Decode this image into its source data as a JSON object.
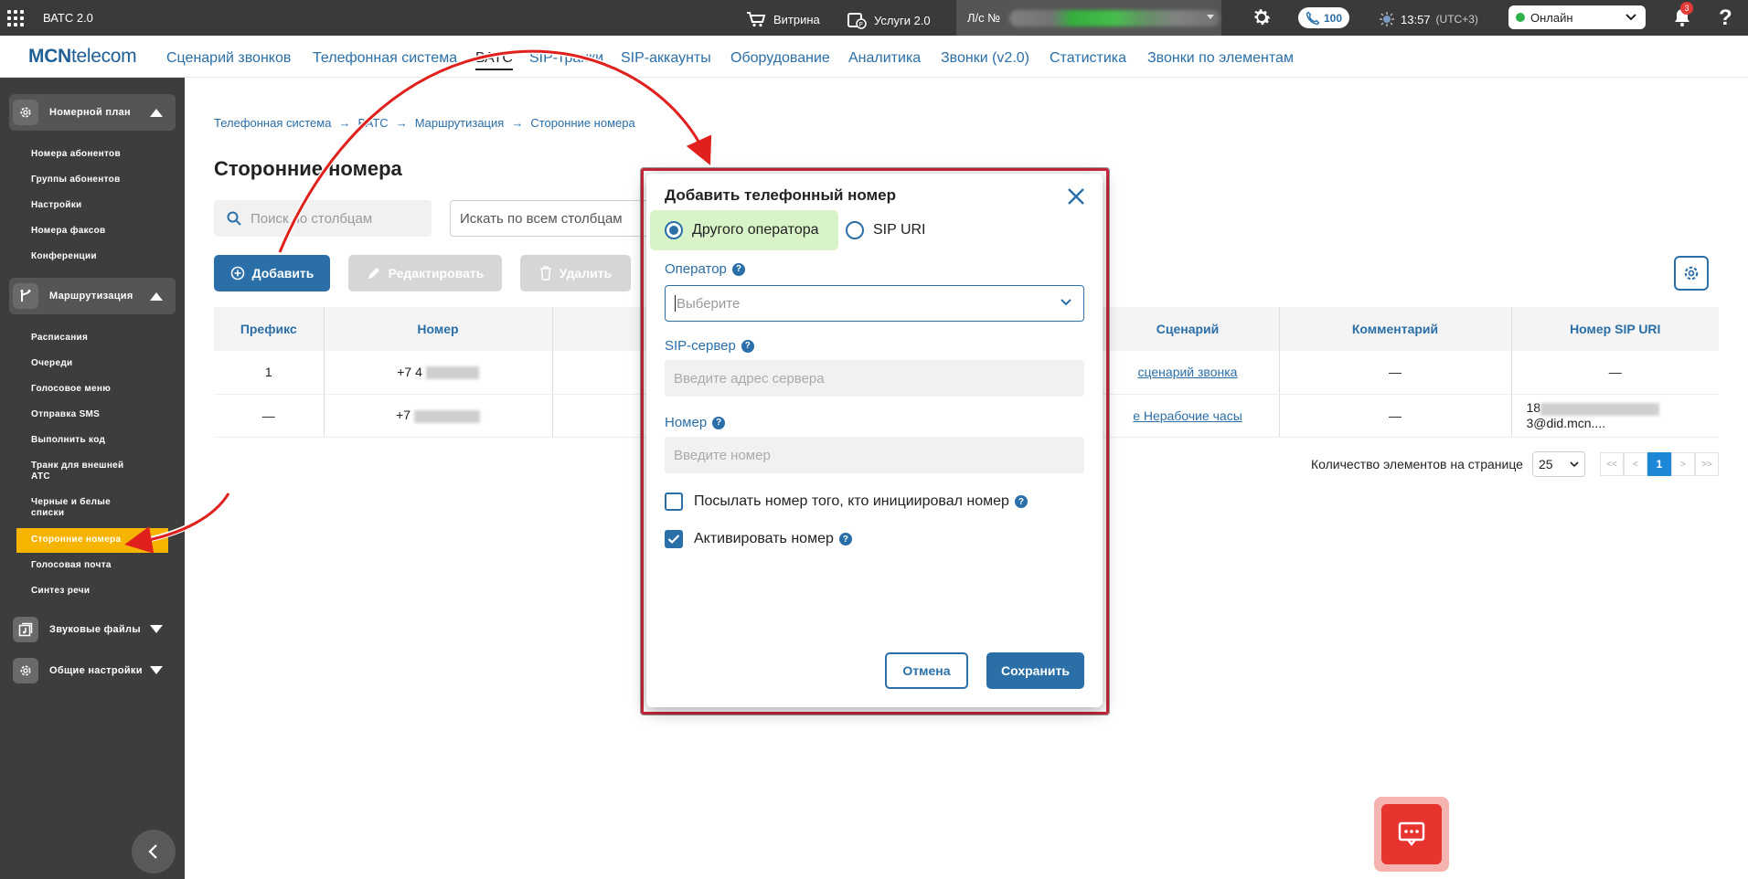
{
  "topbar": {
    "app_title": "ВАТС 2.0",
    "vitrina": "Витрина",
    "services": "Услуги 2.0",
    "account_label": "Л/с №",
    "calls": "100",
    "time": "13:57",
    "timezone": "(UTC+3)",
    "status": "Онлайн",
    "notifications": "3",
    "help": "?"
  },
  "nav": {
    "logo_bold": "MCN",
    "logo_rest": "telecom",
    "items": [
      "Сценарий звонков",
      "Телефонная система",
      "ВАТС",
      "SIP-транки",
      "SIP-аккаунты",
      "Оборудование",
      "Аналитика",
      "Звонки (v2.0)",
      "Статистика",
      "Звонки по элементам"
    ]
  },
  "sidebar": {
    "section_numbering": "Номерной план",
    "numbering_items": [
      "Номера абонентов",
      "Группы абонентов",
      "Настройки",
      "Номера факсов",
      "Конференции"
    ],
    "section_routing": "Маршрутизация",
    "routing_items": [
      "Расписания",
      "Очереди",
      "Голосовое меню",
      "Отправка SMS",
      "Выполнить код",
      "Транк для внешней АТС",
      "Черные и белые списки",
      "Сторонние номера",
      "Голосовая почта",
      "Синтез речи"
    ],
    "section_sounds": "Звуковые файлы",
    "section_general": "Общие настройки"
  },
  "breadcrumb": [
    "Телефонная система",
    "ВАТС",
    "Маршрутизация",
    "Сторонние номера"
  ],
  "page": {
    "title": "Сторонние номера",
    "search_columns_placeholder": "Поиск по столбцам",
    "search_all_placeholder": "Искать по всем столбцам",
    "add_label": "Добавить",
    "edit_label": "Редактировать",
    "delete_label": "Удалить"
  },
  "table": {
    "headers": [
      "Префикс",
      "Номер",
      "",
      "Сценарий",
      "Комментарий",
      "Номер SIP URI"
    ],
    "rows": [
      {
        "prefix": "1",
        "number": "+7 4",
        "scenario": "сценарий звонка",
        "comment": "—",
        "sip_uri": "—"
      },
      {
        "prefix": "—",
        "number": "+7",
        "scenario": "е Нерабочие часы",
        "comment": "—",
        "sip_uri_prefix": "18",
        "sip_uri_suffix": "3@did.mcn...."
      }
    ]
  },
  "pager": {
    "per_page_label": "Количество элементов на странице",
    "per_page": "25",
    "first": "<<",
    "prev": "<",
    "current": "1",
    "next": ">",
    "last": ">>"
  },
  "modal": {
    "title": "Добавить телефонный номер",
    "radio_other": "Другого оператора",
    "radio_sip": "SIP URI",
    "operator_label": "Оператор",
    "operator_placeholder": "Выберите",
    "sip_server_label": "SIP-сервер",
    "sip_server_placeholder": "Введите адрес сервера",
    "number_label": "Номер",
    "number_placeholder": "Введите номер",
    "send_caller_label": "Посылать номер того, кто инициировал номер",
    "activate_label": "Активировать номер",
    "cancel": "Отмена",
    "save": "Сохранить"
  },
  "colors": {
    "accent": "#2a6fa8",
    "active_sidebar": "#f5b400",
    "highlight": "#c6263b"
  }
}
